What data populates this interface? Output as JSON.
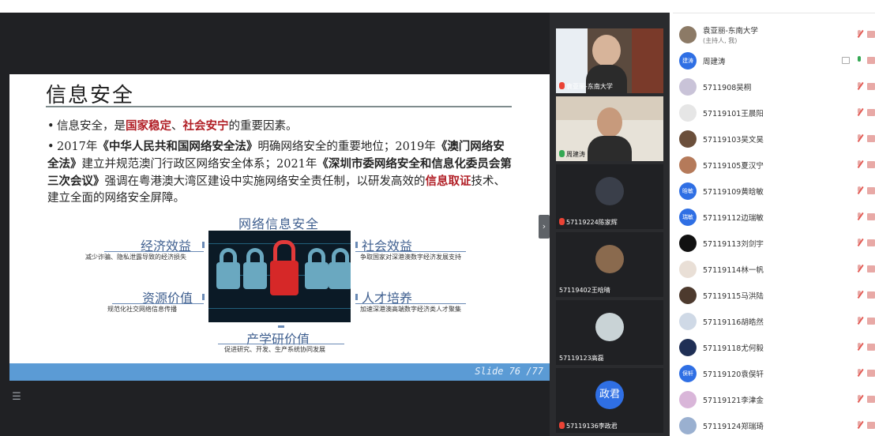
{
  "slide": {
    "title": "信息安全",
    "bullet1": {
      "p1": "信息安全，是",
      "r1": "国家稳定",
      "p2": "、",
      "r2": "社会安宁",
      "p3": "的重要因素。"
    },
    "bullet2": {
      "p1": "2017年",
      "b1": "《中华人民共和国网络安全法》",
      "p2": "明确网络安全的重要地位；2019年",
      "b2": "《澳门网络安全法》",
      "p3": "建立并规范澳门行政区网络安全体系；2021年",
      "b3": "《深圳市委网络安全和信息化委员会第三次会议》",
      "p4": "强调在粤港澳大湾区建设中实施网络安全责任制，以研发高效的",
      "r1": "信息取证",
      "p5": "技术、建立全面的网络安全屏障。"
    },
    "diagram": {
      "title": "网络信息安全",
      "economic": "经济效益",
      "economic_sub": "减少诈骗、隐私泄露导致的经济损失",
      "resource": "资源价值",
      "resource_sub": "规范化社交网络信息传播",
      "social": "社会效益",
      "social_sub": "争取国家对深港澳数字经济发展支持",
      "talent": "人才培养",
      "talent_sub": "加速深港澳高端数字经济类人才聚集",
      "industry": "产学研价值",
      "industry_sub": "促进研究、开发、生产系统协同发展"
    },
    "slide_number": "Slide 76 /77"
  },
  "videos": [
    {
      "name": "袁亚丽-东南大学",
      "mic": "off"
    },
    {
      "name": "周建涛",
      "mic": "on"
    },
    {
      "name": "57119224陈家辉",
      "mic": "off"
    },
    {
      "name": "57119402王晗晴",
      "mic": "none"
    },
    {
      "name": "57119123高磊",
      "mic": "none"
    },
    {
      "name": "57119136李政君",
      "mic": "off",
      "avatar_text": "政君"
    }
  ],
  "participants": [
    {
      "name": "袁亚丽-东南大学",
      "sub": "(主持人, 我)",
      "avatar_color": "#8c7a66",
      "mic": "off"
    },
    {
      "name": "周建涛",
      "avatar_text": "建涛",
      "avatar_color": "#2f6fe4",
      "mic": "on"
    },
    {
      "name": "5711908吴桐",
      "avatar_color": "#c9c3d8",
      "mic": "off"
    },
    {
      "name": "57119101王晨阳",
      "avatar_color": "#e6e6e6",
      "mic": "off"
    },
    {
      "name": "57119103吴文昊",
      "avatar_color": "#6b4f3b",
      "mic": "off"
    },
    {
      "name": "57119105夏汉宁",
      "avatar_color": "#b57a5a",
      "mic": "off"
    },
    {
      "name": "57119109黄晗敏",
      "avatar_text": "晗敏",
      "avatar_color": "#2f6fe4",
      "mic": "off"
    },
    {
      "name": "57119112边瑞敏",
      "avatar_text": "瑞敏",
      "avatar_color": "#2f6fe4",
      "mic": "off"
    },
    {
      "name": "57119113刘剑宇",
      "avatar_color": "#111111",
      "mic": "off"
    },
    {
      "name": "57119114林一帆",
      "avatar_color": "#e9dfd6",
      "mic": "off"
    },
    {
      "name": "57119115马洪陆",
      "avatar_color": "#4d3a2e",
      "mic": "off"
    },
    {
      "name": "57119116胡皓然",
      "avatar_color": "#cfd9e6",
      "mic": "off"
    },
    {
      "name": "57119118尤何毅",
      "avatar_color": "#1f2f55",
      "mic": "off"
    },
    {
      "name": "57119120袁俣轩",
      "avatar_text": "俣轩",
      "avatar_color": "#2f6fe4",
      "mic": "off"
    },
    {
      "name": "57119121李津金",
      "avatar_color": "#d9b6d9",
      "mic": "off"
    },
    {
      "name": "57119124郑瑞琦",
      "avatar_color": "#9ab0d0",
      "mic": "off"
    }
  ],
  "colors": {
    "accent_red": "#b11f26",
    "diagram_blue": "#3f5f8f",
    "footer_blue": "#5b9bd5",
    "brand_blue": "#2f6fe4"
  }
}
